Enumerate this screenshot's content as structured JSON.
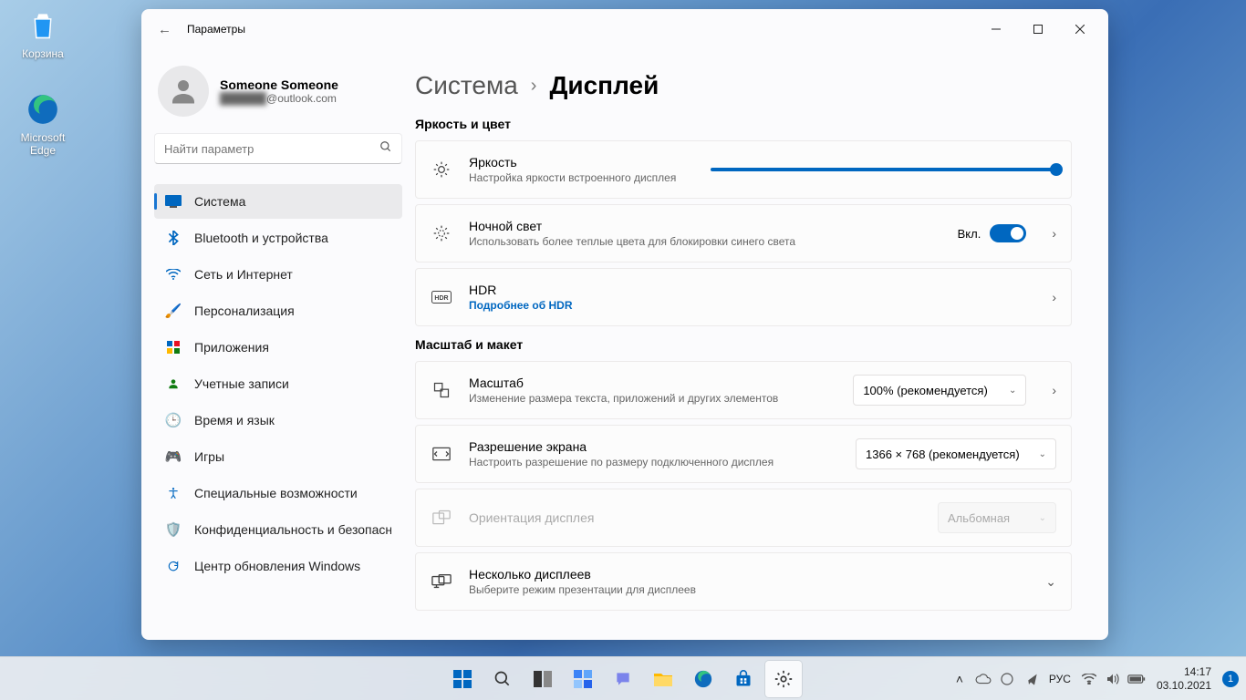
{
  "desktop": {
    "recycle_label": "Корзина",
    "edge_label": "Microsoft Edge"
  },
  "window": {
    "title": "Параметры",
    "user_name": "Someone Someone",
    "user_email_hidden": "██████",
    "user_email_domain": "@outlook.com",
    "search_placeholder": "Найти параметр"
  },
  "nav": [
    {
      "label": "Система",
      "icon": "🖥️",
      "selected": true
    },
    {
      "label": "Bluetooth и устройства",
      "icon": "bt"
    },
    {
      "label": "Сеть и Интернет",
      "icon": "wifi"
    },
    {
      "label": "Персонализация",
      "icon": "🖌️"
    },
    {
      "label": "Приложения",
      "icon": "▦"
    },
    {
      "label": "Учетные записи",
      "icon": "👤"
    },
    {
      "label": "Время и язык",
      "icon": "🌐"
    },
    {
      "label": "Игры",
      "icon": "🎮"
    },
    {
      "label": "Специальные возможности",
      "icon": "acc"
    },
    {
      "label": "Конфиденциальность и безопасность",
      "icon": "🛡️"
    },
    {
      "label": "Центр обновления Windows",
      "icon": "🔄"
    }
  ],
  "breadcrumb": {
    "parent": "Система",
    "current": "Дисплей"
  },
  "sections": {
    "brightness_color": "Яркость и цвет",
    "scale_layout": "Масштаб и макет"
  },
  "opts": {
    "brightness": {
      "title": "Яркость",
      "sub": "Настройка яркости встроенного дисплея",
      "value": 100
    },
    "night": {
      "title": "Ночной свет",
      "sub": "Использовать более теплые цвета для блокировки синего света",
      "toggle_label": "Вкл.",
      "toggle": true
    },
    "hdr": {
      "title": "HDR",
      "link": "Подробнее об HDR"
    },
    "scale": {
      "title": "Масштаб",
      "sub": "Изменение размера текста, приложений и других элементов",
      "value": "100% (рекомендуется)"
    },
    "resolution": {
      "title": "Разрешение экрана",
      "sub": "Настроить разрешение по размеру подключенного дисплея",
      "value": "1366 × 768 (рекомендуется)"
    },
    "orientation": {
      "title": "Ориентация дисплея",
      "value": "Альбомная",
      "disabled": true
    },
    "multi": {
      "title": "Несколько дисплеев",
      "sub": "Выберите режим презентации для дисплеев"
    }
  },
  "taskbar": {
    "lang": "РУС",
    "time": "14:17",
    "date": "03.10.2021",
    "notif": "1"
  }
}
